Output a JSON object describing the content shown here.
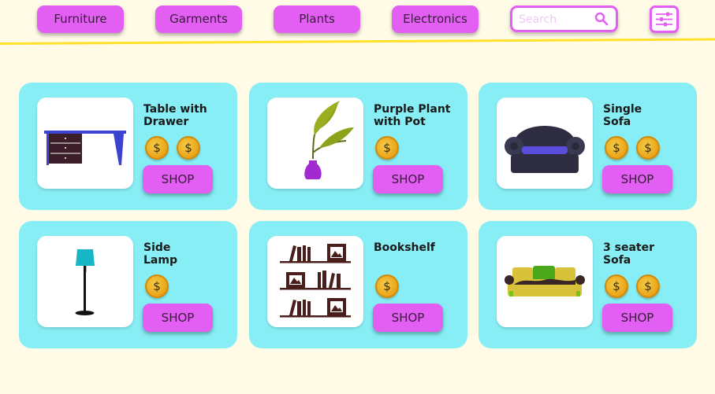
{
  "nav": {
    "categories": [
      {
        "label": "Furniture"
      },
      {
        "label": "Garments"
      },
      {
        "label": "Plants"
      },
      {
        "label": "Electronics"
      }
    ],
    "search": {
      "placeholder": "Search",
      "icon": "search-icon"
    },
    "filter": {
      "icon": "sliders-icon"
    }
  },
  "colors": {
    "background": "#fffbe6",
    "accent": "#e35ef3",
    "card": "#87eef5",
    "divider": "#ffe02a",
    "coin": "#efae22"
  },
  "products": [
    {
      "name_line1": "Table with",
      "name_line2": "Drawer",
      "price_coins": 2,
      "coin_symbol": "$",
      "shop_label": "SHOP",
      "image": "desk-with-drawer"
    },
    {
      "name_line1": "Purple Plant",
      "name_line2": "with Pot",
      "price_coins": 1,
      "coin_symbol": "$",
      "shop_label": "SHOP",
      "image": "plant-in-purple-pot"
    },
    {
      "name_line1": "Single",
      "name_line2": "Sofa",
      "price_coins": 2,
      "coin_symbol": "$",
      "shop_label": "SHOP",
      "image": "armchair"
    },
    {
      "name_line1": "Side",
      "name_line2": "Lamp",
      "price_coins": 1,
      "coin_symbol": "$",
      "shop_label": "SHOP",
      "image": "floor-lamp"
    },
    {
      "name_line1": "Bookshelf",
      "name_line2": "",
      "price_coins": 1,
      "coin_symbol": "$",
      "shop_label": "SHOP",
      "image": "bookshelf"
    },
    {
      "name_line1": "3 seater",
      "name_line2": "Sofa",
      "price_coins": 2,
      "coin_symbol": "$",
      "shop_label": "SHOP",
      "image": "three-seater-sofa"
    }
  ]
}
